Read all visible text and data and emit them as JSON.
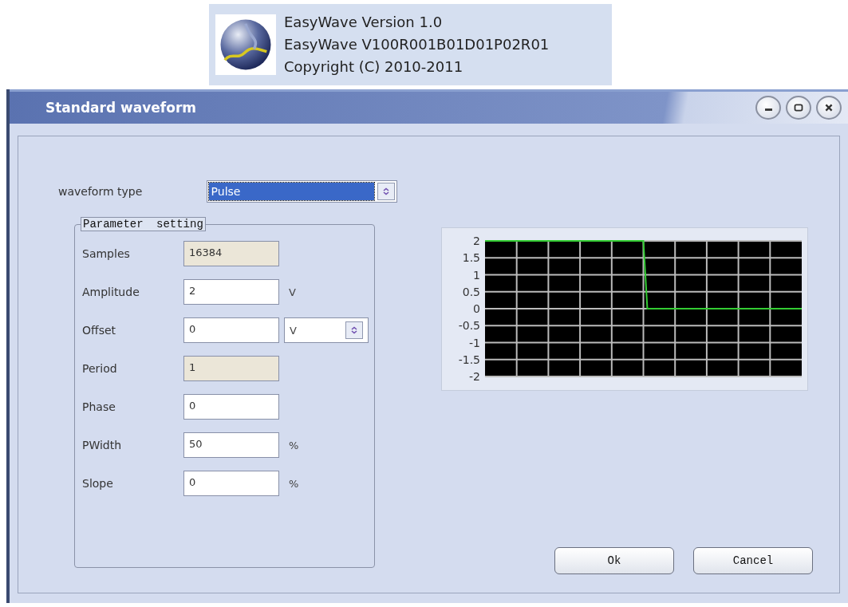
{
  "about": {
    "lines": [
      "EasyWave Version 1.0",
      "EasyWave V100R001B01D01P02R01",
      "Copyright (C) 2010-2011"
    ]
  },
  "window": {
    "title": "Standard waveform"
  },
  "waveform_type": {
    "label": "waveform type",
    "value": "Pulse",
    "selected": true
  },
  "parameter_setting": {
    "title": "Parameter setting",
    "rows": [
      {
        "label": "Samples",
        "value": "16384",
        "disabled": true
      },
      {
        "label": "Amplitude",
        "value": "2",
        "disabled": false,
        "unit": "V",
        "kind": "text"
      },
      {
        "label": "Offset",
        "value": "0",
        "disabled": false,
        "unit": "V",
        "kind": "select"
      },
      {
        "label": "Period",
        "value": "1",
        "disabled": true
      },
      {
        "label": "Phase",
        "value": "0",
        "disabled": false
      },
      {
        "label": "PWidth",
        "value": "50",
        "disabled": false,
        "unit": "%",
        "kind": "text"
      },
      {
        "label": "Slope",
        "value": "0",
        "disabled": false,
        "unit": "%",
        "kind": "text"
      }
    ]
  },
  "preview": {
    "chart_data": {
      "type": "line",
      "ylim": [
        -2,
        2
      ],
      "grid": true,
      "categories": [
        null,
        null,
        null,
        null,
        null,
        null,
        null,
        null,
        null,
        null,
        null,
        null,
        null,
        null,
        null,
        null,
        null,
        null,
        null,
        null,
        null,
        null,
        null,
        null,
        null,
        null,
        null,
        null,
        null,
        null,
        null,
        null,
        null,
        null,
        null,
        null,
        null,
        null,
        null,
        null,
        null,
        null,
        null,
        null,
        null,
        null,
        null,
        null,
        null,
        null,
        null,
        null,
        null,
        null,
        null,
        null,
        null,
        null,
        null,
        null,
        null,
        null,
        null,
        null,
        null,
        null,
        null,
        null,
        null,
        null,
        null,
        null,
        null,
        null,
        null,
        null,
        null,
        null,
        null,
        null,
        null
      ],
      "yticks": [
        {
          "value": 2,
          "label": "2"
        },
        {
          "value": 1.5,
          "label": "1.5"
        },
        {
          "value": 1,
          "label": "1"
        },
        {
          "value": 0.5,
          "label": "0.5"
        },
        {
          "value": 0,
          "label": "0"
        },
        {
          "value": -0.5,
          "label": "-0.5"
        },
        {
          "value": -1,
          "label": "-1"
        },
        {
          "value": -1.5,
          "label": "-1.5"
        },
        {
          "value": -2,
          "label": "-2"
        }
      ],
      "series": [
        {
          "color": "#33cc33",
          "values": [
            2,
            2,
            2,
            2,
            2,
            2,
            2,
            2,
            2,
            2,
            2,
            2,
            2,
            2,
            2,
            2,
            2,
            2,
            2,
            2,
            2,
            2,
            2,
            2,
            2,
            2,
            2,
            2,
            2,
            2,
            2,
            2,
            2,
            2,
            2,
            2,
            2,
            2,
            2,
            2,
            2,
            0,
            0,
            0,
            0,
            0,
            0,
            0,
            0,
            0,
            0,
            0,
            0,
            0,
            0,
            0,
            0,
            0,
            0,
            0,
            0,
            0,
            0,
            0,
            0,
            0,
            0,
            0,
            0,
            0,
            0,
            0,
            0,
            0,
            0,
            0,
            0,
            0,
            0,
            0,
            0
          ]
        }
      ]
    }
  },
  "buttons": [
    "Ok",
    "Cancel"
  ]
}
